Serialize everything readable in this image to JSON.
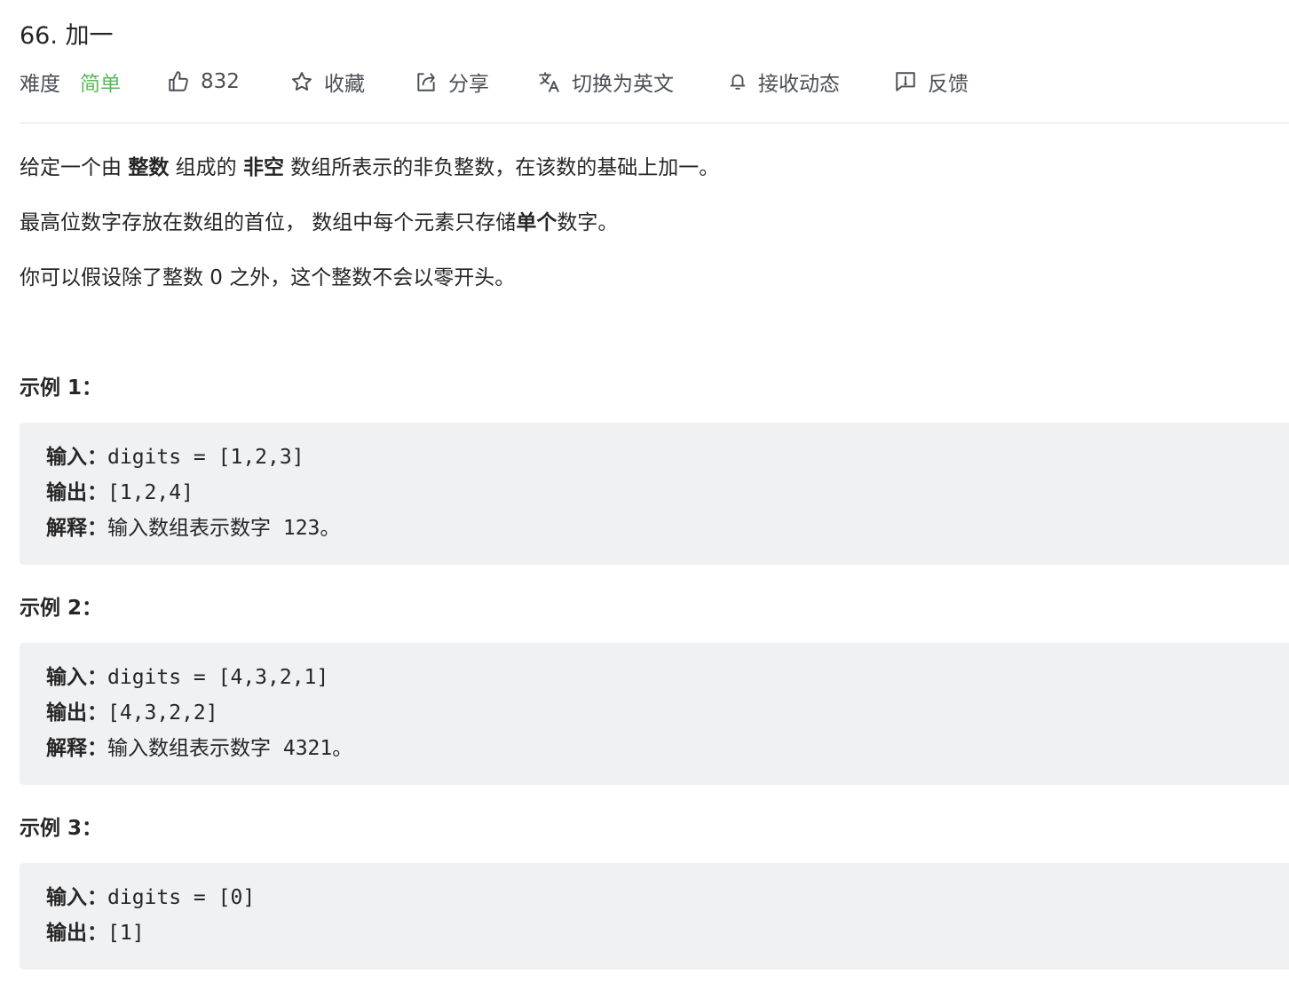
{
  "problem": {
    "title": "66. 加一"
  },
  "toolbar": {
    "difficulty_label": "难度",
    "difficulty_value": "简单",
    "difficulty_color": "#5cb85c",
    "likes": "832",
    "favorite_label": "收藏",
    "share_label": "分享",
    "switch_lang_label": "切换为英文",
    "subscribe_label": "接收动态",
    "feedback_label": "反馈",
    "icons": [
      "thumbs-up-icon",
      "star-icon",
      "share-icon",
      "translate-icon",
      "bell-icon",
      "feedback-icon"
    ]
  },
  "description": {
    "p1_a": "给定一个由 ",
    "p1_b": "整数",
    "p1_c": " 组成的 ",
    "p1_d": "非空",
    "p1_e": " 数组所表示的非负整数，在该数的基础上加一。",
    "p2_a": "最高位数字存放在数组的首位， 数组中每个元素只存储",
    "p2_b": "单个",
    "p2_c": "数字。",
    "p3": "你可以假设除了整数 0 之外，这个整数不会以零开头。"
  },
  "examples": [
    {
      "title": "示例 1：",
      "input_label": "输入：",
      "input_value": "digits = [1,2,3]",
      "output_label": "输出：",
      "output_value": "[1,2,4]",
      "explain_label": "解释：",
      "explain_value": "输入数组表示数字 123。"
    },
    {
      "title": "示例 2：",
      "input_label": "输入：",
      "input_value": "digits = [4,3,2,1]",
      "output_label": "输出：",
      "output_value": "[4,3,2,2]",
      "explain_label": "解释：",
      "explain_value": "输入数组表示数字 4321。"
    },
    {
      "title": "示例 3：",
      "input_label": "输入：",
      "input_value": "digits = [0]",
      "output_label": "输出：",
      "output_value": "[1]"
    }
  ]
}
